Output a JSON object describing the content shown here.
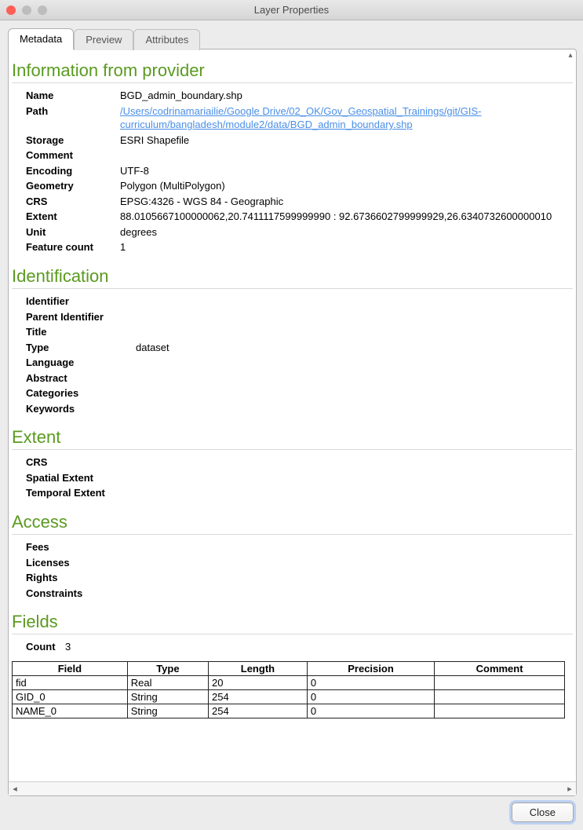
{
  "window": {
    "title": "Layer Properties"
  },
  "tabs": {
    "items": [
      {
        "label": "Metadata",
        "active": true
      },
      {
        "label": "Preview",
        "active": false
      },
      {
        "label": "Attributes",
        "active": false
      }
    ]
  },
  "sections": {
    "provider": {
      "heading": "Information from provider",
      "rows": {
        "name_k": "Name",
        "name_v": "BGD_admin_boundary.shp",
        "path_k": "Path",
        "path_v": "/Users/codrinamariailie/Google Drive/02_OK/Gov_Geospatial_Trainings/git/GIS-curriculum/bangladesh/module2/data/BGD_admin_boundary.shp",
        "storage_k": "Storage",
        "storage_v": "ESRI Shapefile",
        "comment_k": "Comment",
        "comment_v": "",
        "encoding_k": "Encoding",
        "encoding_v": "UTF-8",
        "geometry_k": "Geometry",
        "geometry_v": "Polygon (MultiPolygon)",
        "crs_k": "CRS",
        "crs_v": "EPSG:4326 - WGS 84 - Geographic",
        "extent_k": "Extent",
        "extent_v": "88.0105667100000062,20.7411117599999990 : 92.6736602799999929,26.6340732600000010",
        "unit_k": "Unit",
        "unit_v": "degrees",
        "fcount_k": "Feature count",
        "fcount_v": "1"
      }
    },
    "identification": {
      "heading": "Identification",
      "rows": {
        "identifier_k": "Identifier",
        "identifier_v": "",
        "parent_k": "Parent Identifier",
        "parent_v": "",
        "title_k": "Title",
        "title_v": "",
        "type_k": "Type",
        "type_v": "dataset",
        "language_k": "Language",
        "language_v": "",
        "abstract_k": "Abstract",
        "abstract_v": "",
        "categories_k": "Categories",
        "categories_v": "",
        "keywords_k": "Keywords",
        "keywords_v": ""
      }
    },
    "extent": {
      "heading": "Extent",
      "rows": {
        "crs_k": "CRS",
        "crs_v": "",
        "spatial_k": "Spatial Extent",
        "spatial_v": "",
        "temporal_k": "Temporal Extent",
        "temporal_v": ""
      }
    },
    "access": {
      "heading": "Access",
      "rows": {
        "fees_k": "Fees",
        "fees_v": "",
        "licenses_k": "Licenses",
        "licenses_v": "",
        "rights_k": "Rights",
        "rights_v": "",
        "constraints_k": "Constraints",
        "constraints_v": ""
      }
    },
    "fields": {
      "heading": "Fields",
      "count_k": "Count",
      "count_v": "3",
      "headers": {
        "field": "Field",
        "type": "Type",
        "length": "Length",
        "precision": "Precision",
        "comment": "Comment"
      },
      "rows": [
        {
          "field": "fid",
          "type": "Real",
          "length": "20",
          "precision": "0",
          "comment": ""
        },
        {
          "field": "GID_0",
          "type": "String",
          "length": "254",
          "precision": "0",
          "comment": ""
        },
        {
          "field": "NAME_0",
          "type": "String",
          "length": "254",
          "precision": "0",
          "comment": ""
        }
      ]
    }
  },
  "footer": {
    "close_label": "Close"
  }
}
